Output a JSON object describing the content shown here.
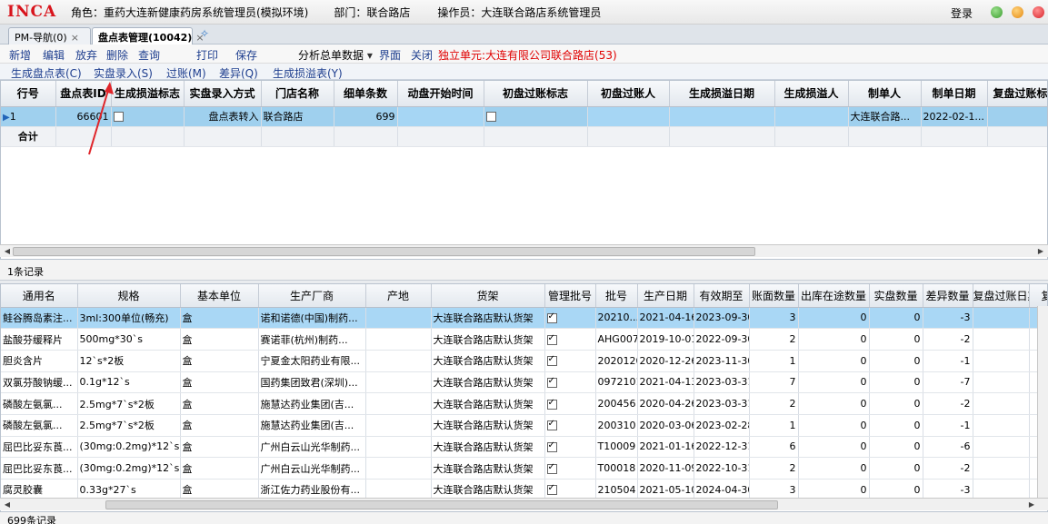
{
  "app": {
    "logo": "INCA",
    "role": "角色：重药大连新健康药房系统管理员(模拟环境)",
    "department": "部门：联合路店",
    "operator": "操作员：大连联合路店系统管理员",
    "login_label": "登录"
  },
  "tabs": [
    {
      "label": "PM-导航(0)",
      "close": "×"
    },
    {
      "label": "盘点表管理(10042)",
      "close": "×"
    }
  ],
  "tab_add": "✧",
  "menu": {
    "new": "新增",
    "edit": "编辑",
    "discard": "放弃",
    "delete": "删除",
    "query": "查询",
    "print": "打印",
    "save": "保存",
    "analysis": "分析总单数据",
    "ui": "界面",
    "close": "关闭",
    "unit": "独立单元:大连有限公司联合路店(53)"
  },
  "subbar": {
    "gen_count_sheet": "生成盘点表(C)",
    "actual_entry": "实盘录入(S)",
    "post": "过账(M)",
    "diff": "差异(Q)",
    "gen_loss_sheet": "生成损溢表(Y)"
  },
  "upper_grid": {
    "columns": [
      "行号",
      "盘点表ID",
      "生成损溢标志",
      "实盘录入方式",
      "门店名称",
      "细单条数",
      "动盘开始时间",
      "初盘过账标志",
      "初盘过账人",
      "生成损溢日期",
      "生成损溢人",
      "制单人",
      "制单日期",
      "复盘过账标志"
    ],
    "rows": [
      {
        "row_no": "1",
        "id": "66601",
        "loss_flag": false,
        "entry_mode": "盘点表转入",
        "store": "联合路店",
        "detail_count": "699",
        "start_time": "",
        "first_post_flag": false,
        "first_poster": "",
        "loss_date": "",
        "loss_person": "",
        "creator": "大连联合路...",
        "create_date": "2022-02-1...",
        "re_post_flag": ""
      }
    ],
    "total_label": "合计",
    "record_count": "1条记录"
  },
  "lower_grid": {
    "columns": [
      "通用名",
      "规格",
      "基本单位",
      "生产厂商",
      "产地",
      "货架",
      "管理批号",
      "批号",
      "生产日期",
      "有效期至",
      "账面数量",
      "出库在途数量",
      "实盘数量",
      "差异数量",
      "复盘过账日期",
      "复"
    ],
    "rows": [
      {
        "name": "鲑谷腾岛素注...",
        "spec": "3ml:300单位(畅充)",
        "unit": "盒",
        "maker": "诺和诺德(中国)制药...",
        "origin": "",
        "shelf": "大连联合路店默认货架",
        "batch_mgmt": true,
        "batch": "20210...",
        "prod_date": "2021-04-16",
        "expiry": "2023-09-30",
        "book_qty": "3",
        "transit_qty": "0",
        "actual_qty": "0",
        "diff_qty": "-3"
      },
      {
        "name": "盐酸芬缓释片",
        "spec": "500mg*30`s",
        "unit": "盒",
        "maker": "赛诺菲(杭州)制药...",
        "origin": "",
        "shelf": "大连联合路店默认货架",
        "batch_mgmt": true,
        "batch": "AHG0071",
        "prod_date": "2019-10-01",
        "expiry": "2022-09-30",
        "book_qty": "2",
        "transit_qty": "0",
        "actual_qty": "0",
        "diff_qty": "-2"
      },
      {
        "name": "胆炎含片",
        "spec": "12`s*2板",
        "unit": "盒",
        "maker": "宁夏金太阳药业有限...",
        "origin": "",
        "shelf": "大连联合路店默认货架",
        "batch_mgmt": true,
        "batch": "20201203",
        "prod_date": "2020-12-26",
        "expiry": "2023-11-30",
        "book_qty": "1",
        "transit_qty": "0",
        "actual_qty": "0",
        "diff_qty": "-1"
      },
      {
        "name": "双氯芬酸钠缓...",
        "spec": "0.1g*12`s",
        "unit": "盒",
        "maker": "国药集团致君(深圳)...",
        "origin": "",
        "shelf": "大连联合路店默认货架",
        "batch_mgmt": true,
        "batch": "09721013",
        "prod_date": "2021-04-13",
        "expiry": "2023-03-31",
        "book_qty": "7",
        "transit_qty": "0",
        "actual_qty": "0",
        "diff_qty": "-7"
      },
      {
        "name": "磷酸左氨氯...",
        "spec": "2.5mg*7`s*2板",
        "unit": "盒",
        "maker": "施慧达药业集团(吉...",
        "origin": "",
        "shelf": "大连联合路店默认货架",
        "batch_mgmt": true,
        "batch": "200456",
        "prod_date": "2020-04-26",
        "expiry": "2023-03-31",
        "book_qty": "2",
        "transit_qty": "0",
        "actual_qty": "0",
        "diff_qty": "-2"
      },
      {
        "name": "磷酸左氨氯...",
        "spec": "2.5mg*7`s*2板",
        "unit": "盒",
        "maker": "施慧达药业集团(吉...",
        "origin": "",
        "shelf": "大连联合路店默认货架",
        "batch_mgmt": true,
        "batch": "200310",
        "prod_date": "2020-03-06",
        "expiry": "2023-02-28",
        "book_qty": "1",
        "transit_qty": "0",
        "actual_qty": "0",
        "diff_qty": "-1"
      },
      {
        "name": "屈巴比妥东莨...",
        "spec": "(30mg:0.2mg)*12`s",
        "unit": "盒",
        "maker": "广州白云山光华制药...",
        "origin": "",
        "shelf": "大连联合路店默认货架",
        "batch_mgmt": true,
        "batch": "T10009",
        "prod_date": "2021-01-16",
        "expiry": "2022-12-31",
        "book_qty": "6",
        "transit_qty": "0",
        "actual_qty": "0",
        "diff_qty": "-6"
      },
      {
        "name": "屈巴比妥东莨...",
        "spec": "(30mg:0.2mg)*12`s",
        "unit": "盒",
        "maker": "广州白云山光华制药...",
        "origin": "",
        "shelf": "大连联合路店默认货架",
        "batch_mgmt": true,
        "batch": "T00018",
        "prod_date": "2020-11-09",
        "expiry": "2022-10-31",
        "book_qty": "2",
        "transit_qty": "0",
        "actual_qty": "0",
        "diff_qty": "-2"
      },
      {
        "name": "腐灵胶囊",
        "spec": "0.33g*27`s",
        "unit": "盒",
        "maker": "浙江佐力药业股份有...",
        "origin": "",
        "shelf": "大连联合路店默认货架",
        "batch_mgmt": true,
        "batch": "210504",
        "prod_date": "2021-05-10",
        "expiry": "2024-04-30",
        "book_qty": "3",
        "transit_qty": "0",
        "actual_qty": "0",
        "diff_qty": "-3"
      }
    ],
    "record_count": "699条记录"
  },
  "colors": {
    "accent_red": "#d8141c",
    "selected_row": "#9fd0ee",
    "link_blue": "#1f3f8f",
    "annotation_red": "#e0252a"
  }
}
